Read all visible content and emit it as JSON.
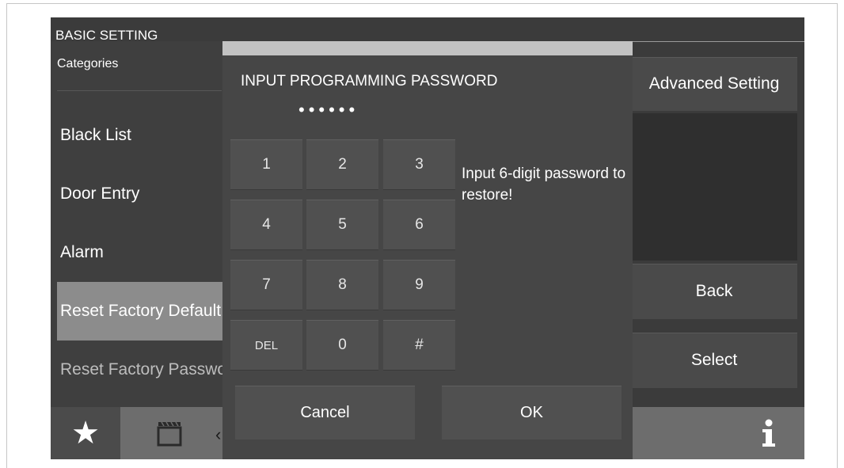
{
  "screen": {
    "title": "BASIC SETTING",
    "sidebar": {
      "header": "Categories",
      "items": [
        {
          "label": "Black List"
        },
        {
          "label": "Door Entry"
        },
        {
          "label": "Alarm"
        },
        {
          "label": "Reset Factory Default",
          "selected": true
        },
        {
          "label": "Reset Factory Password"
        }
      ]
    },
    "right_panel": {
      "advanced_label": "Advanced Setting",
      "back_label": "Back",
      "select_label": "Select"
    },
    "bottom_bar": {
      "icons": [
        "star-icon",
        "clapperboard-icon",
        "arrow-left-icon",
        "info-icon"
      ]
    }
  },
  "dialog": {
    "title": "INPUT PROGRAMMING PASSWORD",
    "password_masked": "••••••",
    "keys": [
      "1",
      "2",
      "3",
      "4",
      "5",
      "6",
      "7",
      "8",
      "9",
      "DEL",
      "0",
      "#"
    ],
    "hint": "Input 6-digit password to restore!",
    "cancel_label": "Cancel",
    "ok_label": "OK"
  },
  "colors": {
    "screen_bg": "#3b3b3b",
    "dialog_bg": "#464646",
    "dialog_header": "#c2c2c2",
    "selected_item": "#8c8c8c",
    "bottom_bar": "#6d6d6d"
  }
}
